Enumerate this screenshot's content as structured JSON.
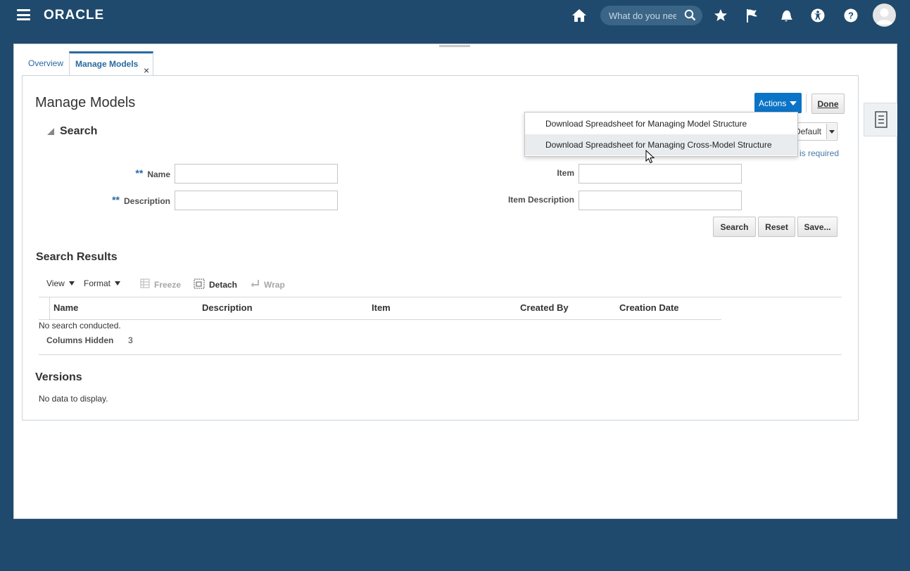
{
  "header": {
    "logo_text": "ORACLE",
    "search_placeholder": "What do you need?",
    "icons": [
      "menu-icon",
      "home-icon",
      "search-icon",
      "favorites-star-icon",
      "watchlist-flag-icon",
      "notifications-bell-icon",
      "accessibility-icon",
      "help-icon",
      "user-avatar"
    ]
  },
  "tabs": [
    {
      "label": "Overview"
    },
    {
      "label": "Manage Models",
      "close": "×"
    }
  ],
  "page": {
    "title": "Manage Models",
    "actions_label": "Actions",
    "done_label": "Done"
  },
  "search": {
    "title": "Search",
    "saved_search_value": "Default",
    "required_note": "** At least one is required",
    "required_marker": "**",
    "fields": {
      "name_label": "Name",
      "description_label": "Description",
      "item_label": "Item",
      "item_description_label": "Item Description"
    },
    "buttons": {
      "search": "Search",
      "reset": "Reset",
      "save": "Save..."
    }
  },
  "results": {
    "title": "Search Results",
    "toolbar": {
      "view": "View",
      "format": "Format",
      "freeze": "Freeze",
      "detach": "Detach",
      "wrap": "Wrap"
    },
    "columns": [
      "Name",
      "Description",
      "Item",
      "Created By",
      "Creation Date"
    ],
    "empty_text": "No search conducted.",
    "columns_hidden_label": "Columns Hidden",
    "columns_hidden_value": "3"
  },
  "versions": {
    "title": "Versions",
    "empty_text": "No data to display."
  },
  "actions_menu": {
    "items": [
      "Download Spreadsheet for Managing Model Structure",
      "Download Spreadsheet for Managing Cross-Model Structure"
    ],
    "hovered_index": 1
  },
  "colors": {
    "header_bg": "#1f4a6d",
    "accent_blue": "#0b74c7",
    "link_blue": "#2b6aa1"
  }
}
